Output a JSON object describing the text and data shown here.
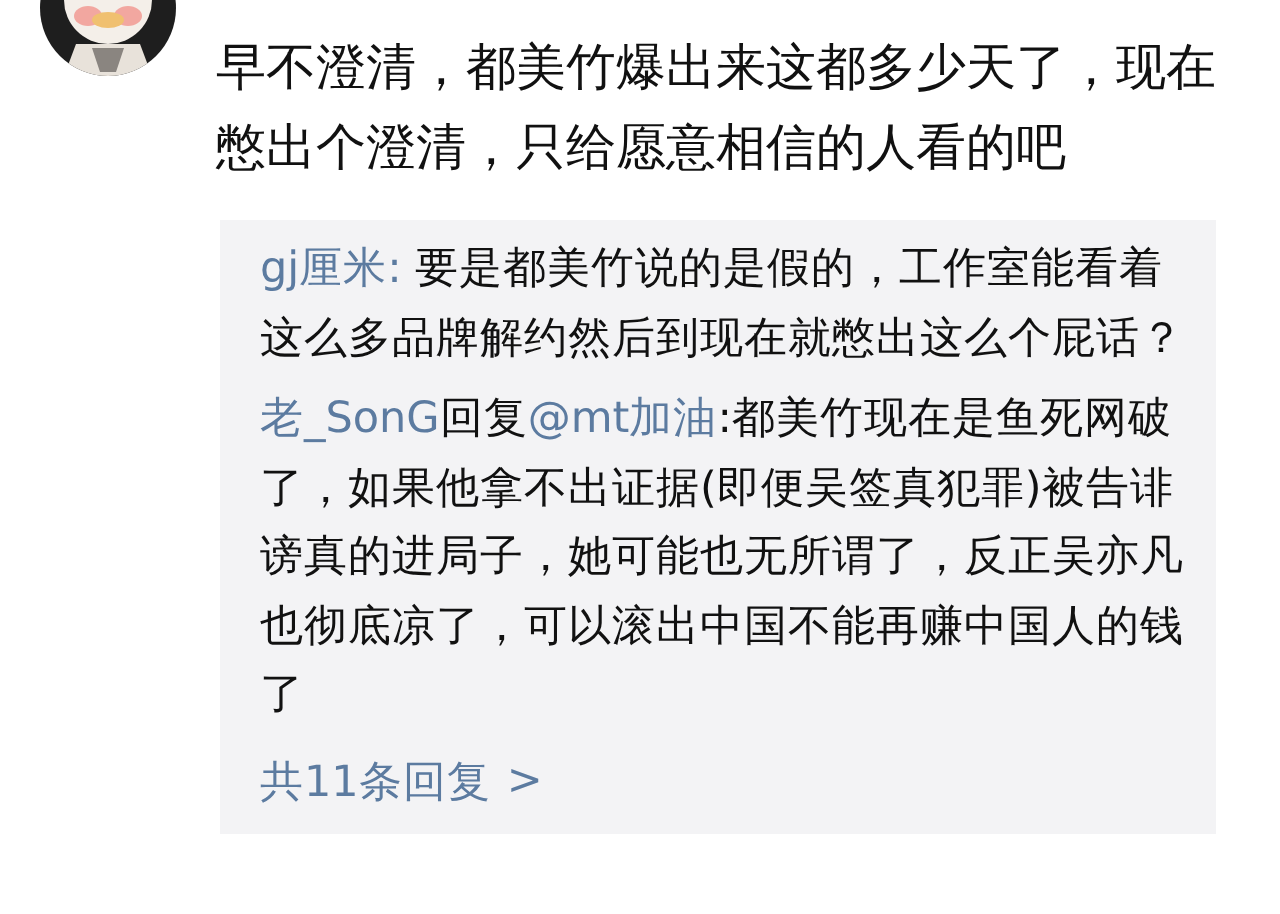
{
  "comment": {
    "text": "早不澄清，都美竹爆出来这都多少天了，现在憋出个澄清，只给愿意相信的人看的吧"
  },
  "replies": [
    {
      "user": "gj厘米:",
      "text": " 要是都美竹说的是假的，工作室能看着这么多品牌解约然后到现在就憋出这么个屁话？"
    },
    {
      "user": "老_SonG",
      "reply_word": "回复",
      "mention": "@mt加油",
      "text": ":都美竹现在是鱼死网破了，如果他拿不出证据(即便吴签真犯罪)被告诽谤真的进局子，她可能也无所谓了，反正吴亦凡也彻底凉了，可以滚出中国不能再赚中国人的钱了"
    }
  ],
  "more_replies": {
    "label": "共11条回复",
    "arrow": ">"
  }
}
